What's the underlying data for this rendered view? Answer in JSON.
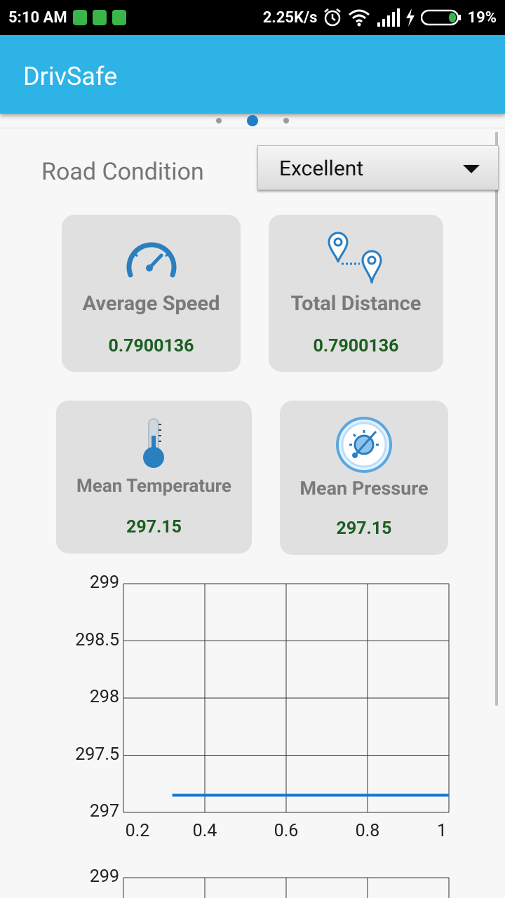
{
  "status_bar": {
    "time": "5:10 AM",
    "network_speed": "2.25K/s",
    "battery_percent": "19%",
    "icons": [
      "notification-icon",
      "android-icon",
      "android-icon",
      "alarm-icon",
      "wifi-icon",
      "signal-icon",
      "charging-icon",
      "battery-icon"
    ]
  },
  "app": {
    "title": "DrivSafe"
  },
  "pager": {
    "page_count": 3,
    "active_page": 2
  },
  "road_condition": {
    "label": "Road Condition",
    "selected": "Excellent"
  },
  "cards": {
    "average_speed": {
      "label": "Average Speed",
      "value": "0.7900136",
      "icon": "speedometer-icon"
    },
    "total_distance": {
      "label": "Total Distance",
      "value": "0.7900136",
      "icon": "route-pins-icon"
    },
    "mean_temperature": {
      "label": "Mean Temperature",
      "value": "297.15",
      "icon": "thermometer-icon"
    },
    "mean_pressure": {
      "label": "Mean Pressure",
      "value": "297.15",
      "icon": "pressure-gauge-icon"
    }
  },
  "colors": {
    "app_bar": "#2eb3e6",
    "card_value": "#1b5e20",
    "chart_line": "#1976d2"
  },
  "chart_data": [
    {
      "type": "line",
      "xlim": [
        0.2,
        1
      ],
      "ylim": [
        297,
        299
      ],
      "x_ticks": [
        "0.2",
        "0.4",
        "0.6",
        "0.8",
        "1"
      ],
      "y_ticks": [
        "299",
        "298.5",
        "298",
        "297.5",
        "297"
      ],
      "grid": true,
      "series": [
        {
          "x": [
            0.32,
            1.0
          ],
          "y": [
            297.15,
            297.15
          ]
        }
      ]
    },
    {
      "type": "line",
      "y_ticks": [
        "299"
      ],
      "grid": true,
      "partially_visible": true
    }
  ]
}
